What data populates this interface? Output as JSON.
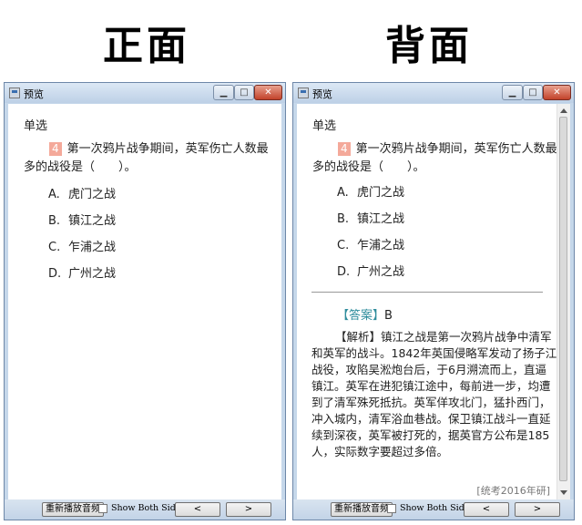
{
  "labels": {
    "front": "正面",
    "back": "背面"
  },
  "window": {
    "title": "预览",
    "controls": {
      "minimize": "▁",
      "maximize": "□",
      "close": "✕"
    }
  },
  "question": {
    "type": "单选",
    "number": "4",
    "stem": "第一次鸦片战争期间，英军伤亡人数最多的战役是（　　）。",
    "options": [
      {
        "letter": "A.",
        "text": "虎门之战"
      },
      {
        "letter": "B.",
        "text": "镇江之战"
      },
      {
        "letter": "C.",
        "text": "乍浦之战"
      },
      {
        "letter": "D.",
        "text": "广州之战"
      }
    ]
  },
  "answer": {
    "tag": "【答案】",
    "value": "B",
    "analysis": "【解析】镇江之战是第一次鸦片战争中清军和英军的战斗。1842年英国侵略军发动了扬子江战役，攻陷吴淞炮台后，于6月溯流而上，直逼镇江。英军在进犯镇江途中，每前进一步，均遭到了清军殊死抵抗。英军佯攻北门，猛扑西门，冲入城内，清军浴血巷战。保卫镇江战斗一直延续到深夜，英军被打死的，据英官方公布是185人，实际数字要超过多倍。",
    "source": "[统考2016年研]"
  },
  "toolbar": {
    "replay": "重新播放音频",
    "show_both": "Show Both Sides",
    "prev": "<",
    "next": ">"
  },
  "colors": {
    "number_badge": "#f4a99a",
    "answer_tag": "#2e8c9c"
  }
}
